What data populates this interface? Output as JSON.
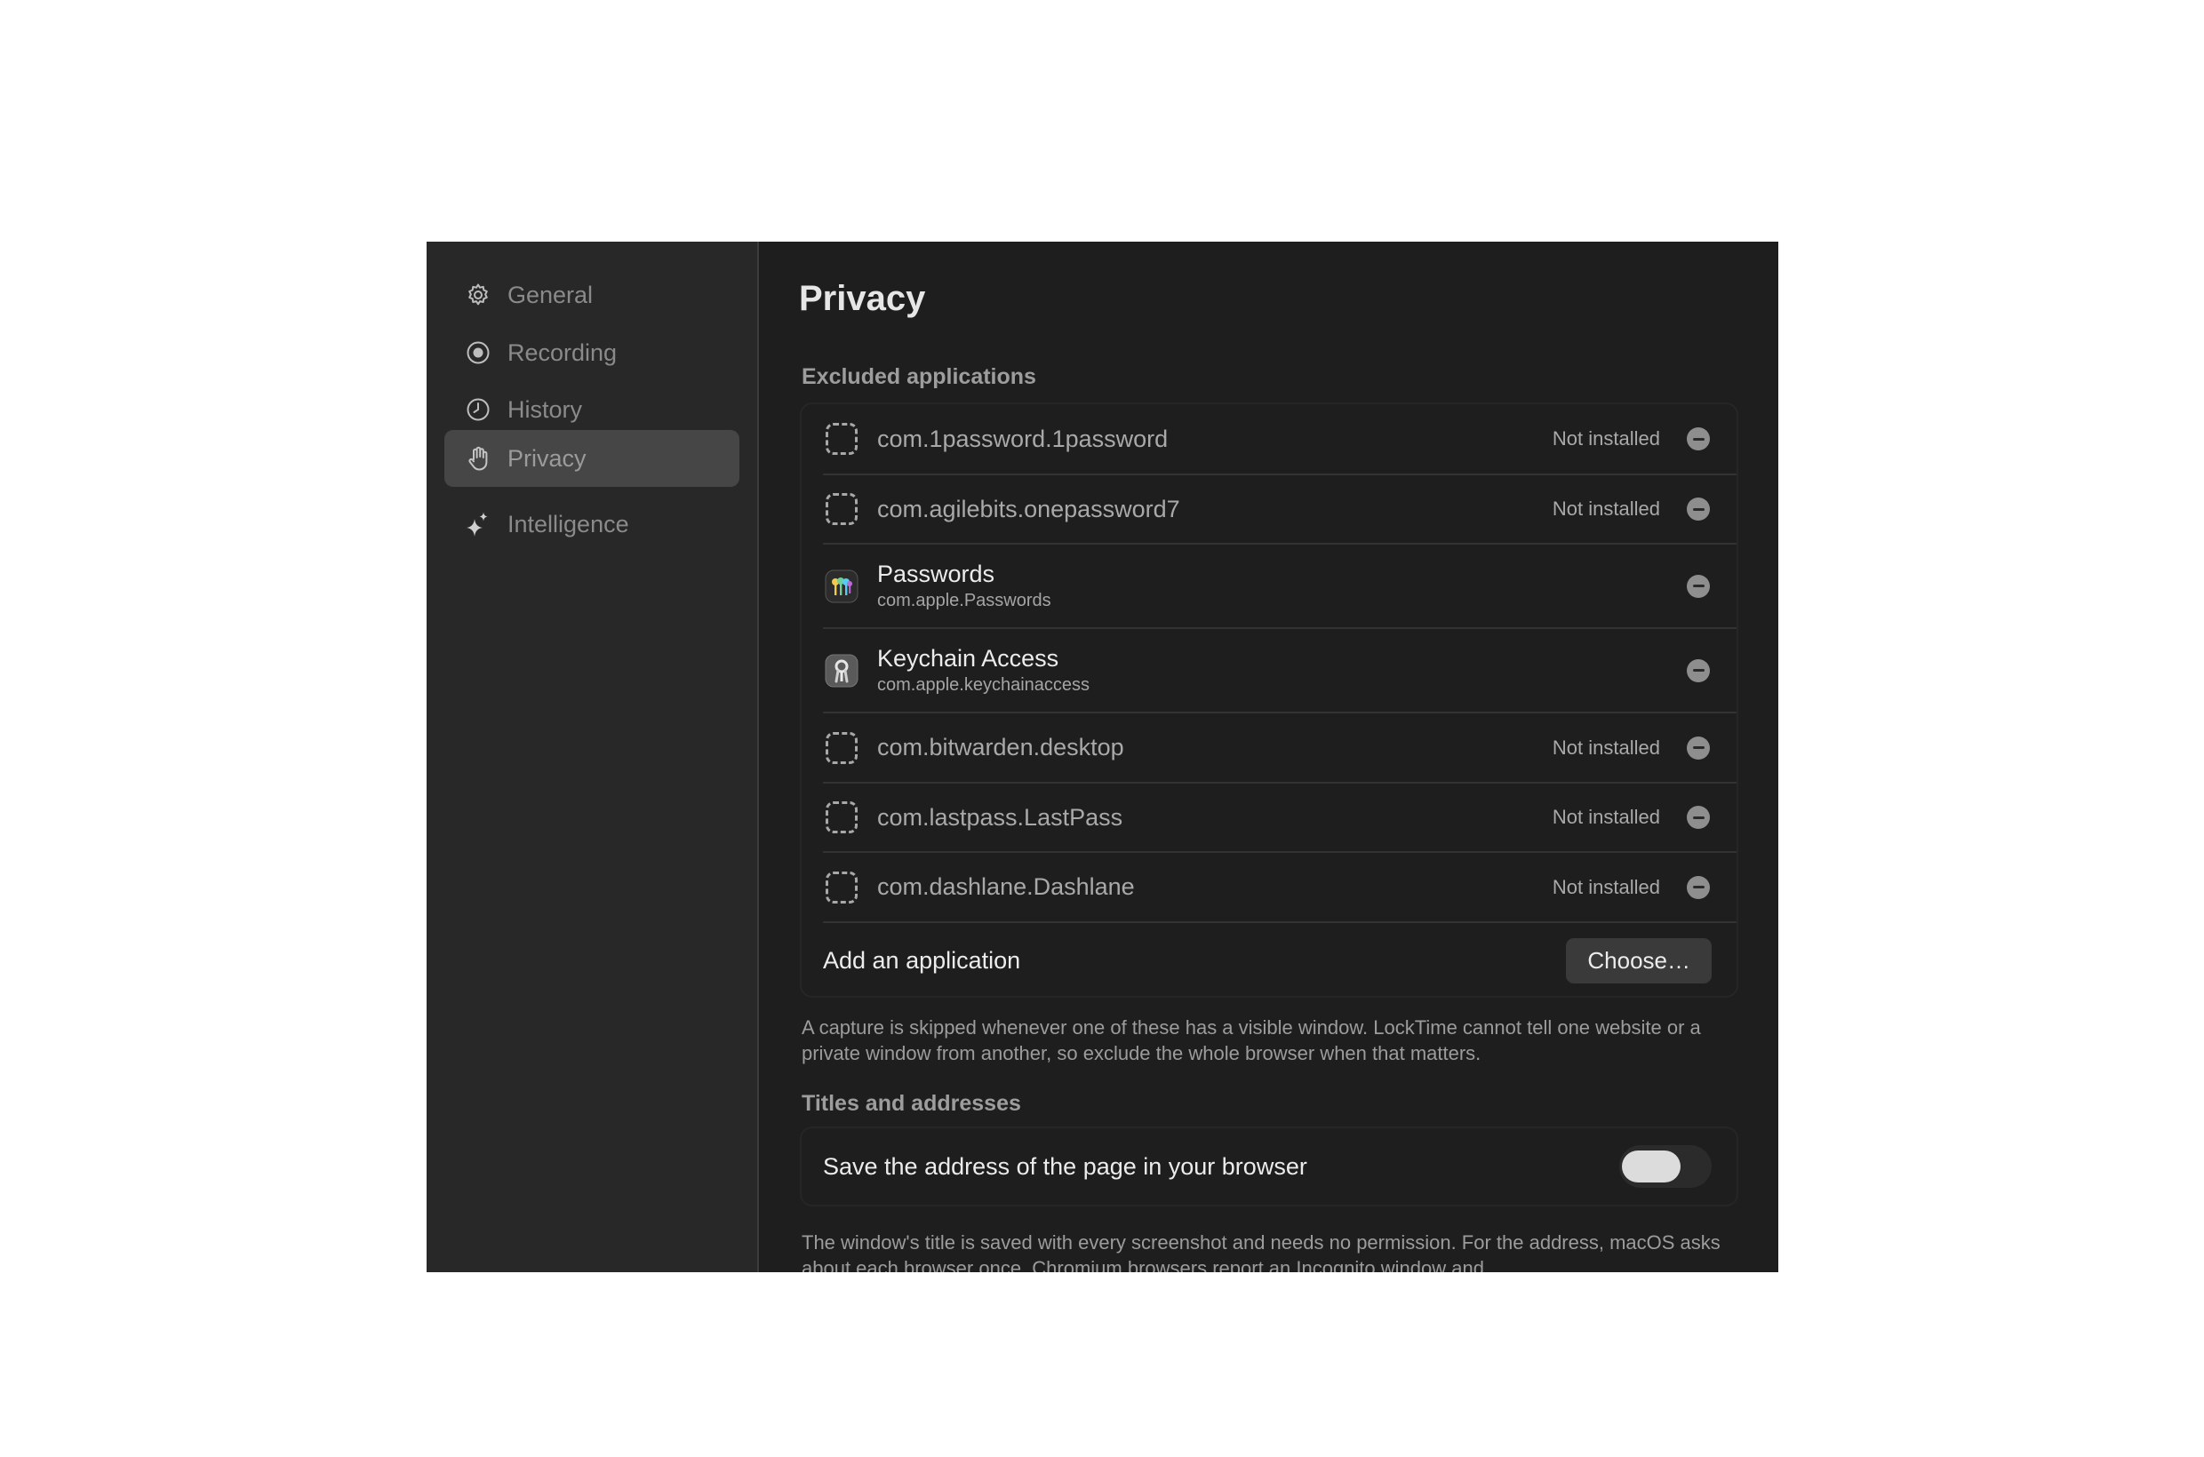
{
  "sidebar": {
    "items": [
      {
        "label": "General",
        "icon": "gear-icon"
      },
      {
        "label": "Recording",
        "icon": "record-icon"
      },
      {
        "label": "History",
        "icon": "clock-icon"
      },
      {
        "label": "Privacy",
        "icon": "hand-icon",
        "active": true
      },
      {
        "label": "Intelligence",
        "icon": "sparkle-icon"
      }
    ]
  },
  "page": {
    "title": "Privacy"
  },
  "excluded": {
    "heading": "Excluded applications",
    "apps": [
      {
        "name": "com.1password.1password",
        "status": "Not installed"
      },
      {
        "name": "com.agilebits.onepassword7",
        "status": "Not installed"
      },
      {
        "name": "Passwords",
        "bundle": "com.apple.Passwords",
        "icon": "passwords-app-icon"
      },
      {
        "name": "Keychain Access",
        "bundle": "com.apple.keychainaccess",
        "icon": "keychain-app-icon"
      },
      {
        "name": "com.bitwarden.desktop",
        "status": "Not installed"
      },
      {
        "name": "com.lastpass.LastPass",
        "status": "Not installed"
      },
      {
        "name": "com.dashlane.Dashlane",
        "status": "Not installed"
      }
    ],
    "add_label": "Add an application",
    "choose_label": "Choose…",
    "help": "A capture is skipped whenever one of these has a visible window. LockTime cannot tell one website or a private window from another, so exclude the whole browser when that matters."
  },
  "titles": {
    "heading": "Titles and addresses",
    "toggle_label": "Save the address of the page in your browser",
    "toggle_on": false,
    "help": "The window's title is saved with every screenshot and needs no permission. For the address, macOS asks about each browser once. Chromium browsers report an Incognito window and"
  }
}
